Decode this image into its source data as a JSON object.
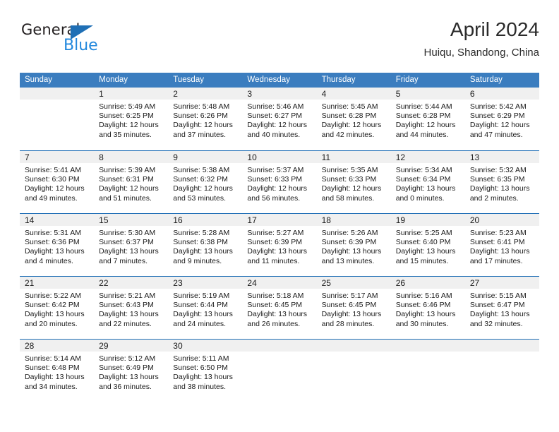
{
  "brand": {
    "name_top": "General",
    "name_bottom": "Blue",
    "triangle_color": "#1f6fb5",
    "blue_color": "#2288dd"
  },
  "header": {
    "title": "April 2024",
    "subtitle": "Huiqu, Shandong, China"
  },
  "theme": {
    "header_row_bg": "#3b7dbf",
    "week_divider": "#1c6cb5",
    "date_band_bg": "#f0f0f0"
  },
  "weekdays": [
    "Sunday",
    "Monday",
    "Tuesday",
    "Wednesday",
    "Thursday",
    "Friday",
    "Saturday"
  ],
  "weeks": [
    [
      {
        "day": "",
        "empty": true,
        "lines": []
      },
      {
        "day": "1",
        "lines": [
          "Sunrise: 5:49 AM",
          "Sunset: 6:25 PM",
          "Daylight: 12 hours",
          "and 35 minutes."
        ]
      },
      {
        "day": "2",
        "lines": [
          "Sunrise: 5:48 AM",
          "Sunset: 6:26 PM",
          "Daylight: 12 hours",
          "and 37 minutes."
        ]
      },
      {
        "day": "3",
        "lines": [
          "Sunrise: 5:46 AM",
          "Sunset: 6:27 PM",
          "Daylight: 12 hours",
          "and 40 minutes."
        ]
      },
      {
        "day": "4",
        "lines": [
          "Sunrise: 5:45 AM",
          "Sunset: 6:28 PM",
          "Daylight: 12 hours",
          "and 42 minutes."
        ]
      },
      {
        "day": "5",
        "lines": [
          "Sunrise: 5:44 AM",
          "Sunset: 6:28 PM",
          "Daylight: 12 hours",
          "and 44 minutes."
        ]
      },
      {
        "day": "6",
        "lines": [
          "Sunrise: 5:42 AM",
          "Sunset: 6:29 PM",
          "Daylight: 12 hours",
          "and 47 minutes."
        ]
      }
    ],
    [
      {
        "day": "7",
        "lines": [
          "Sunrise: 5:41 AM",
          "Sunset: 6:30 PM",
          "Daylight: 12 hours",
          "and 49 minutes."
        ]
      },
      {
        "day": "8",
        "lines": [
          "Sunrise: 5:39 AM",
          "Sunset: 6:31 PM",
          "Daylight: 12 hours",
          "and 51 minutes."
        ]
      },
      {
        "day": "9",
        "lines": [
          "Sunrise: 5:38 AM",
          "Sunset: 6:32 PM",
          "Daylight: 12 hours",
          "and 53 minutes."
        ]
      },
      {
        "day": "10",
        "lines": [
          "Sunrise: 5:37 AM",
          "Sunset: 6:33 PM",
          "Daylight: 12 hours",
          "and 56 minutes."
        ]
      },
      {
        "day": "11",
        "lines": [
          "Sunrise: 5:35 AM",
          "Sunset: 6:33 PM",
          "Daylight: 12 hours",
          "and 58 minutes."
        ]
      },
      {
        "day": "12",
        "lines": [
          "Sunrise: 5:34 AM",
          "Sunset: 6:34 PM",
          "Daylight: 13 hours",
          "and 0 minutes."
        ]
      },
      {
        "day": "13",
        "lines": [
          "Sunrise: 5:32 AM",
          "Sunset: 6:35 PM",
          "Daylight: 13 hours",
          "and 2 minutes."
        ]
      }
    ],
    [
      {
        "day": "14",
        "lines": [
          "Sunrise: 5:31 AM",
          "Sunset: 6:36 PM",
          "Daylight: 13 hours",
          "and 4 minutes."
        ]
      },
      {
        "day": "15",
        "lines": [
          "Sunrise: 5:30 AM",
          "Sunset: 6:37 PM",
          "Daylight: 13 hours",
          "and 7 minutes."
        ]
      },
      {
        "day": "16",
        "lines": [
          "Sunrise: 5:28 AM",
          "Sunset: 6:38 PM",
          "Daylight: 13 hours",
          "and 9 minutes."
        ]
      },
      {
        "day": "17",
        "lines": [
          "Sunrise: 5:27 AM",
          "Sunset: 6:39 PM",
          "Daylight: 13 hours",
          "and 11 minutes."
        ]
      },
      {
        "day": "18",
        "lines": [
          "Sunrise: 5:26 AM",
          "Sunset: 6:39 PM",
          "Daylight: 13 hours",
          "and 13 minutes."
        ]
      },
      {
        "day": "19",
        "lines": [
          "Sunrise: 5:25 AM",
          "Sunset: 6:40 PM",
          "Daylight: 13 hours",
          "and 15 minutes."
        ]
      },
      {
        "day": "20",
        "lines": [
          "Sunrise: 5:23 AM",
          "Sunset: 6:41 PM",
          "Daylight: 13 hours",
          "and 17 minutes."
        ]
      }
    ],
    [
      {
        "day": "21",
        "lines": [
          "Sunrise: 5:22 AM",
          "Sunset: 6:42 PM",
          "Daylight: 13 hours",
          "and 20 minutes."
        ]
      },
      {
        "day": "22",
        "lines": [
          "Sunrise: 5:21 AM",
          "Sunset: 6:43 PM",
          "Daylight: 13 hours",
          "and 22 minutes."
        ]
      },
      {
        "day": "23",
        "lines": [
          "Sunrise: 5:19 AM",
          "Sunset: 6:44 PM",
          "Daylight: 13 hours",
          "and 24 minutes."
        ]
      },
      {
        "day": "24",
        "lines": [
          "Sunrise: 5:18 AM",
          "Sunset: 6:45 PM",
          "Daylight: 13 hours",
          "and 26 minutes."
        ]
      },
      {
        "day": "25",
        "lines": [
          "Sunrise: 5:17 AM",
          "Sunset: 6:45 PM",
          "Daylight: 13 hours",
          "and 28 minutes."
        ]
      },
      {
        "day": "26",
        "lines": [
          "Sunrise: 5:16 AM",
          "Sunset: 6:46 PM",
          "Daylight: 13 hours",
          "and 30 minutes."
        ]
      },
      {
        "day": "27",
        "lines": [
          "Sunrise: 5:15 AM",
          "Sunset: 6:47 PM",
          "Daylight: 13 hours",
          "and 32 minutes."
        ]
      }
    ],
    [
      {
        "day": "28",
        "lines": [
          "Sunrise: 5:14 AM",
          "Sunset: 6:48 PM",
          "Daylight: 13 hours",
          "and 34 minutes."
        ]
      },
      {
        "day": "29",
        "lines": [
          "Sunrise: 5:12 AM",
          "Sunset: 6:49 PM",
          "Daylight: 13 hours",
          "and 36 minutes."
        ]
      },
      {
        "day": "30",
        "lines": [
          "Sunrise: 5:11 AM",
          "Sunset: 6:50 PM",
          "Daylight: 13 hours",
          "and 38 minutes."
        ]
      },
      {
        "day": "",
        "empty": true,
        "lines": []
      },
      {
        "day": "",
        "empty": true,
        "lines": []
      },
      {
        "day": "",
        "empty": true,
        "lines": []
      },
      {
        "day": "",
        "empty": true,
        "lines": []
      }
    ]
  ]
}
